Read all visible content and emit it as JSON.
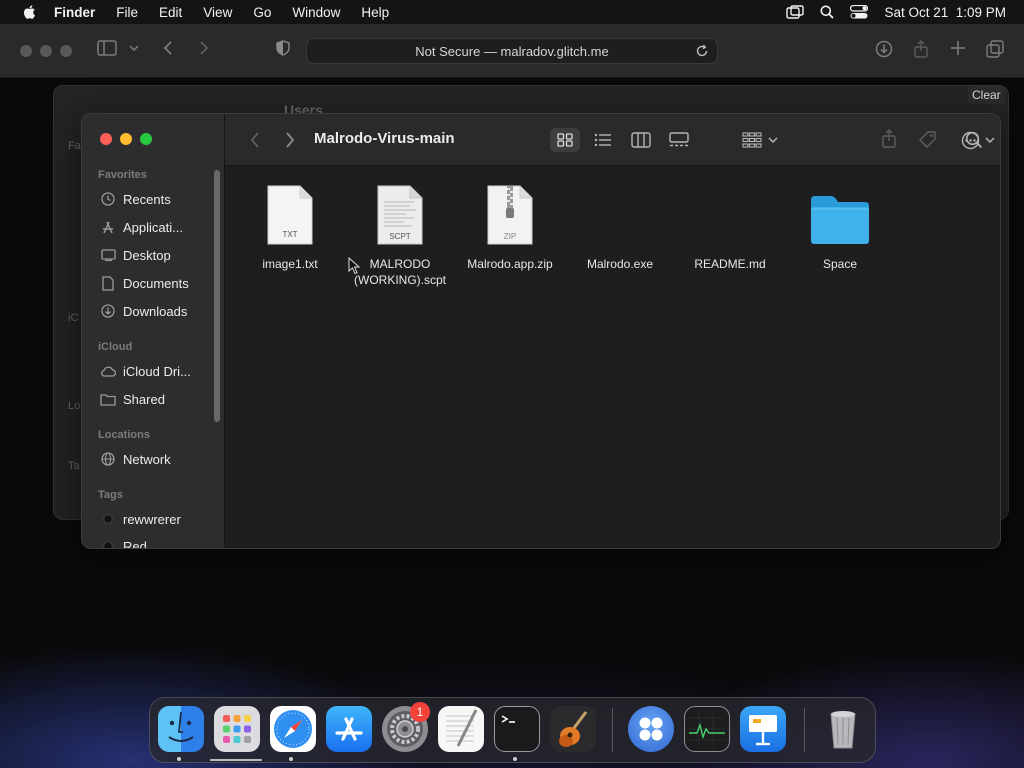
{
  "menubar": {
    "app_name": "Finder",
    "items": [
      "File",
      "Edit",
      "View",
      "Go",
      "Window",
      "Help"
    ],
    "datetime": "Sat Oct 21  1:09 PM"
  },
  "safari": {
    "address": "Not Secure — malradov.glitch.me",
    "clear_label": "Clear"
  },
  "background_window": {
    "title": "Users",
    "side_fragments": [
      "Fa",
      "iC",
      "Lo",
      "Ta"
    ]
  },
  "finder": {
    "title": "Malrodo-Virus-main",
    "sidebar": {
      "favorites_label": "Favorites",
      "favorites": [
        {
          "label": "Recents",
          "icon": "clock-icon"
        },
        {
          "label": "Applicati...",
          "icon": "applications-icon"
        },
        {
          "label": "Desktop",
          "icon": "desktop-icon"
        },
        {
          "label": "Documents",
          "icon": "document-icon"
        },
        {
          "label": "Downloads",
          "icon": "downloads-icon"
        }
      ],
      "icloud_label": "iCloud",
      "icloud": [
        {
          "label": "iCloud Dri...",
          "icon": "cloud-icon"
        },
        {
          "label": "Shared",
          "icon": "shared-folder-icon"
        }
      ],
      "locations_label": "Locations",
      "locations": [
        {
          "label": "Network",
          "icon": "globe-icon"
        }
      ],
      "tags_label": "Tags",
      "tags": [
        {
          "label": "rewwrerer",
          "color": "#111111"
        },
        {
          "label": "Red",
          "color": "#111111"
        }
      ]
    },
    "files": [
      {
        "name": "image1.txt",
        "kind": "TXT"
      },
      {
        "name": "MALRODO (WORKING).scpt",
        "kind": "SCPT"
      },
      {
        "name": "Malrodo.app.zip",
        "kind": "ZIP"
      },
      {
        "name": "Malrodo.exe",
        "kind": ""
      },
      {
        "name": "README.md",
        "kind": ""
      },
      {
        "name": "Space",
        "kind": "folder"
      }
    ]
  },
  "dock": {
    "apps": [
      "Finder",
      "Launchpad",
      "Safari",
      "App Store",
      "System Settings",
      "TextEdit",
      "Terminal",
      "GarageBand",
      "Widget App",
      "Activity Monitor",
      "Keynote",
      "Trash"
    ],
    "badge_count": "1"
  },
  "colors": {
    "accent": "#2f9cf0",
    "folder_blue": "#3fb2ec",
    "traffic_red": "#fe5f57",
    "traffic_yellow": "#febc2e",
    "traffic_green": "#28c840"
  }
}
